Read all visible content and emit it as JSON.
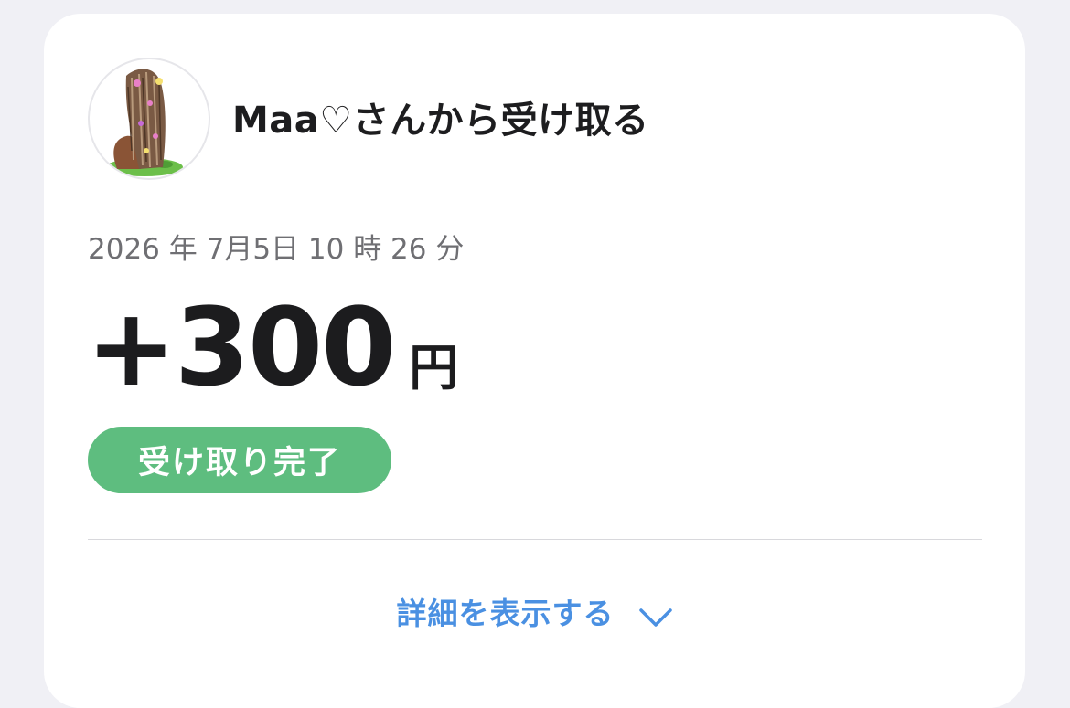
{
  "transfer": {
    "title": "Maa♡さんから受け取る",
    "datetime": "2026 年 7月5日 10 時 26 分",
    "amount": "+300",
    "currency": "円",
    "status": "受け取り完了",
    "details_link": "詳細を表示する"
  },
  "icons": {
    "avatar": "profile-avatar",
    "expand": "chevron-down-icon"
  },
  "colors": {
    "background": "#f0f0f5",
    "card": "#ffffff",
    "status_badge": "#5ebd7f",
    "link": "#4a90e2",
    "text_primary": "#1c1c1e",
    "text_secondary": "#6f6f73"
  }
}
